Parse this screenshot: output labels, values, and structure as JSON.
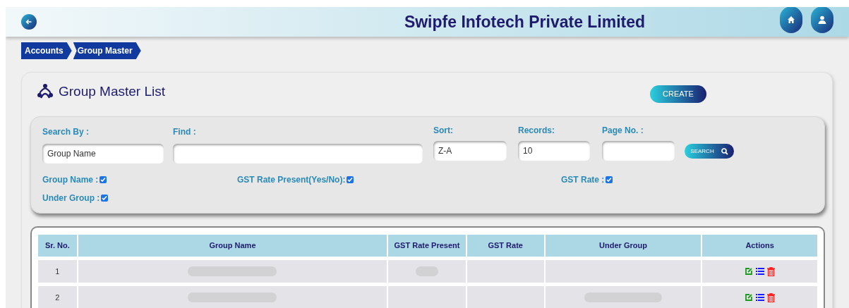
{
  "header": {
    "title": "Swipfe Infotech Private Limited"
  },
  "breadcrumb": [
    "Accounts",
    "Group Master"
  ],
  "page": {
    "title": "Group Master List",
    "create_button": "CREATE"
  },
  "filters": {
    "fields": [
      {
        "label": "Search By :",
        "value": "Group Name"
      },
      {
        "label": "Find :"
      },
      {
        "label": "Sort:",
        "value": "Z-A"
      },
      {
        "label": "Records:",
        "value": "10"
      },
      {
        "label": "Page No. :"
      }
    ],
    "search_button": "SEARCH",
    "columns_toggle": [
      {
        "label": "Group Name :",
        "checked": true
      },
      {
        "label": "GST Rate Present(Yes/No):",
        "checked": true
      },
      {
        "label": "GST Rate :",
        "checked": true
      },
      {
        "label": "Under Group :",
        "checked": true
      }
    ]
  },
  "table": {
    "columns": [
      "Sr. No.",
      "Group Name",
      "GST Rate Present",
      "GST Rate",
      "Under Group",
      "Actions"
    ],
    "rows": [
      {
        "sr_no": "1",
        "group_name_redacted": true,
        "gst_rate_present_redacted": true,
        "under_group_redacted": false
      },
      {
        "sr_no": "2",
        "group_name_redacted": true,
        "gst_rate_present_redacted": false,
        "under_group_redacted": true
      }
    ]
  }
}
